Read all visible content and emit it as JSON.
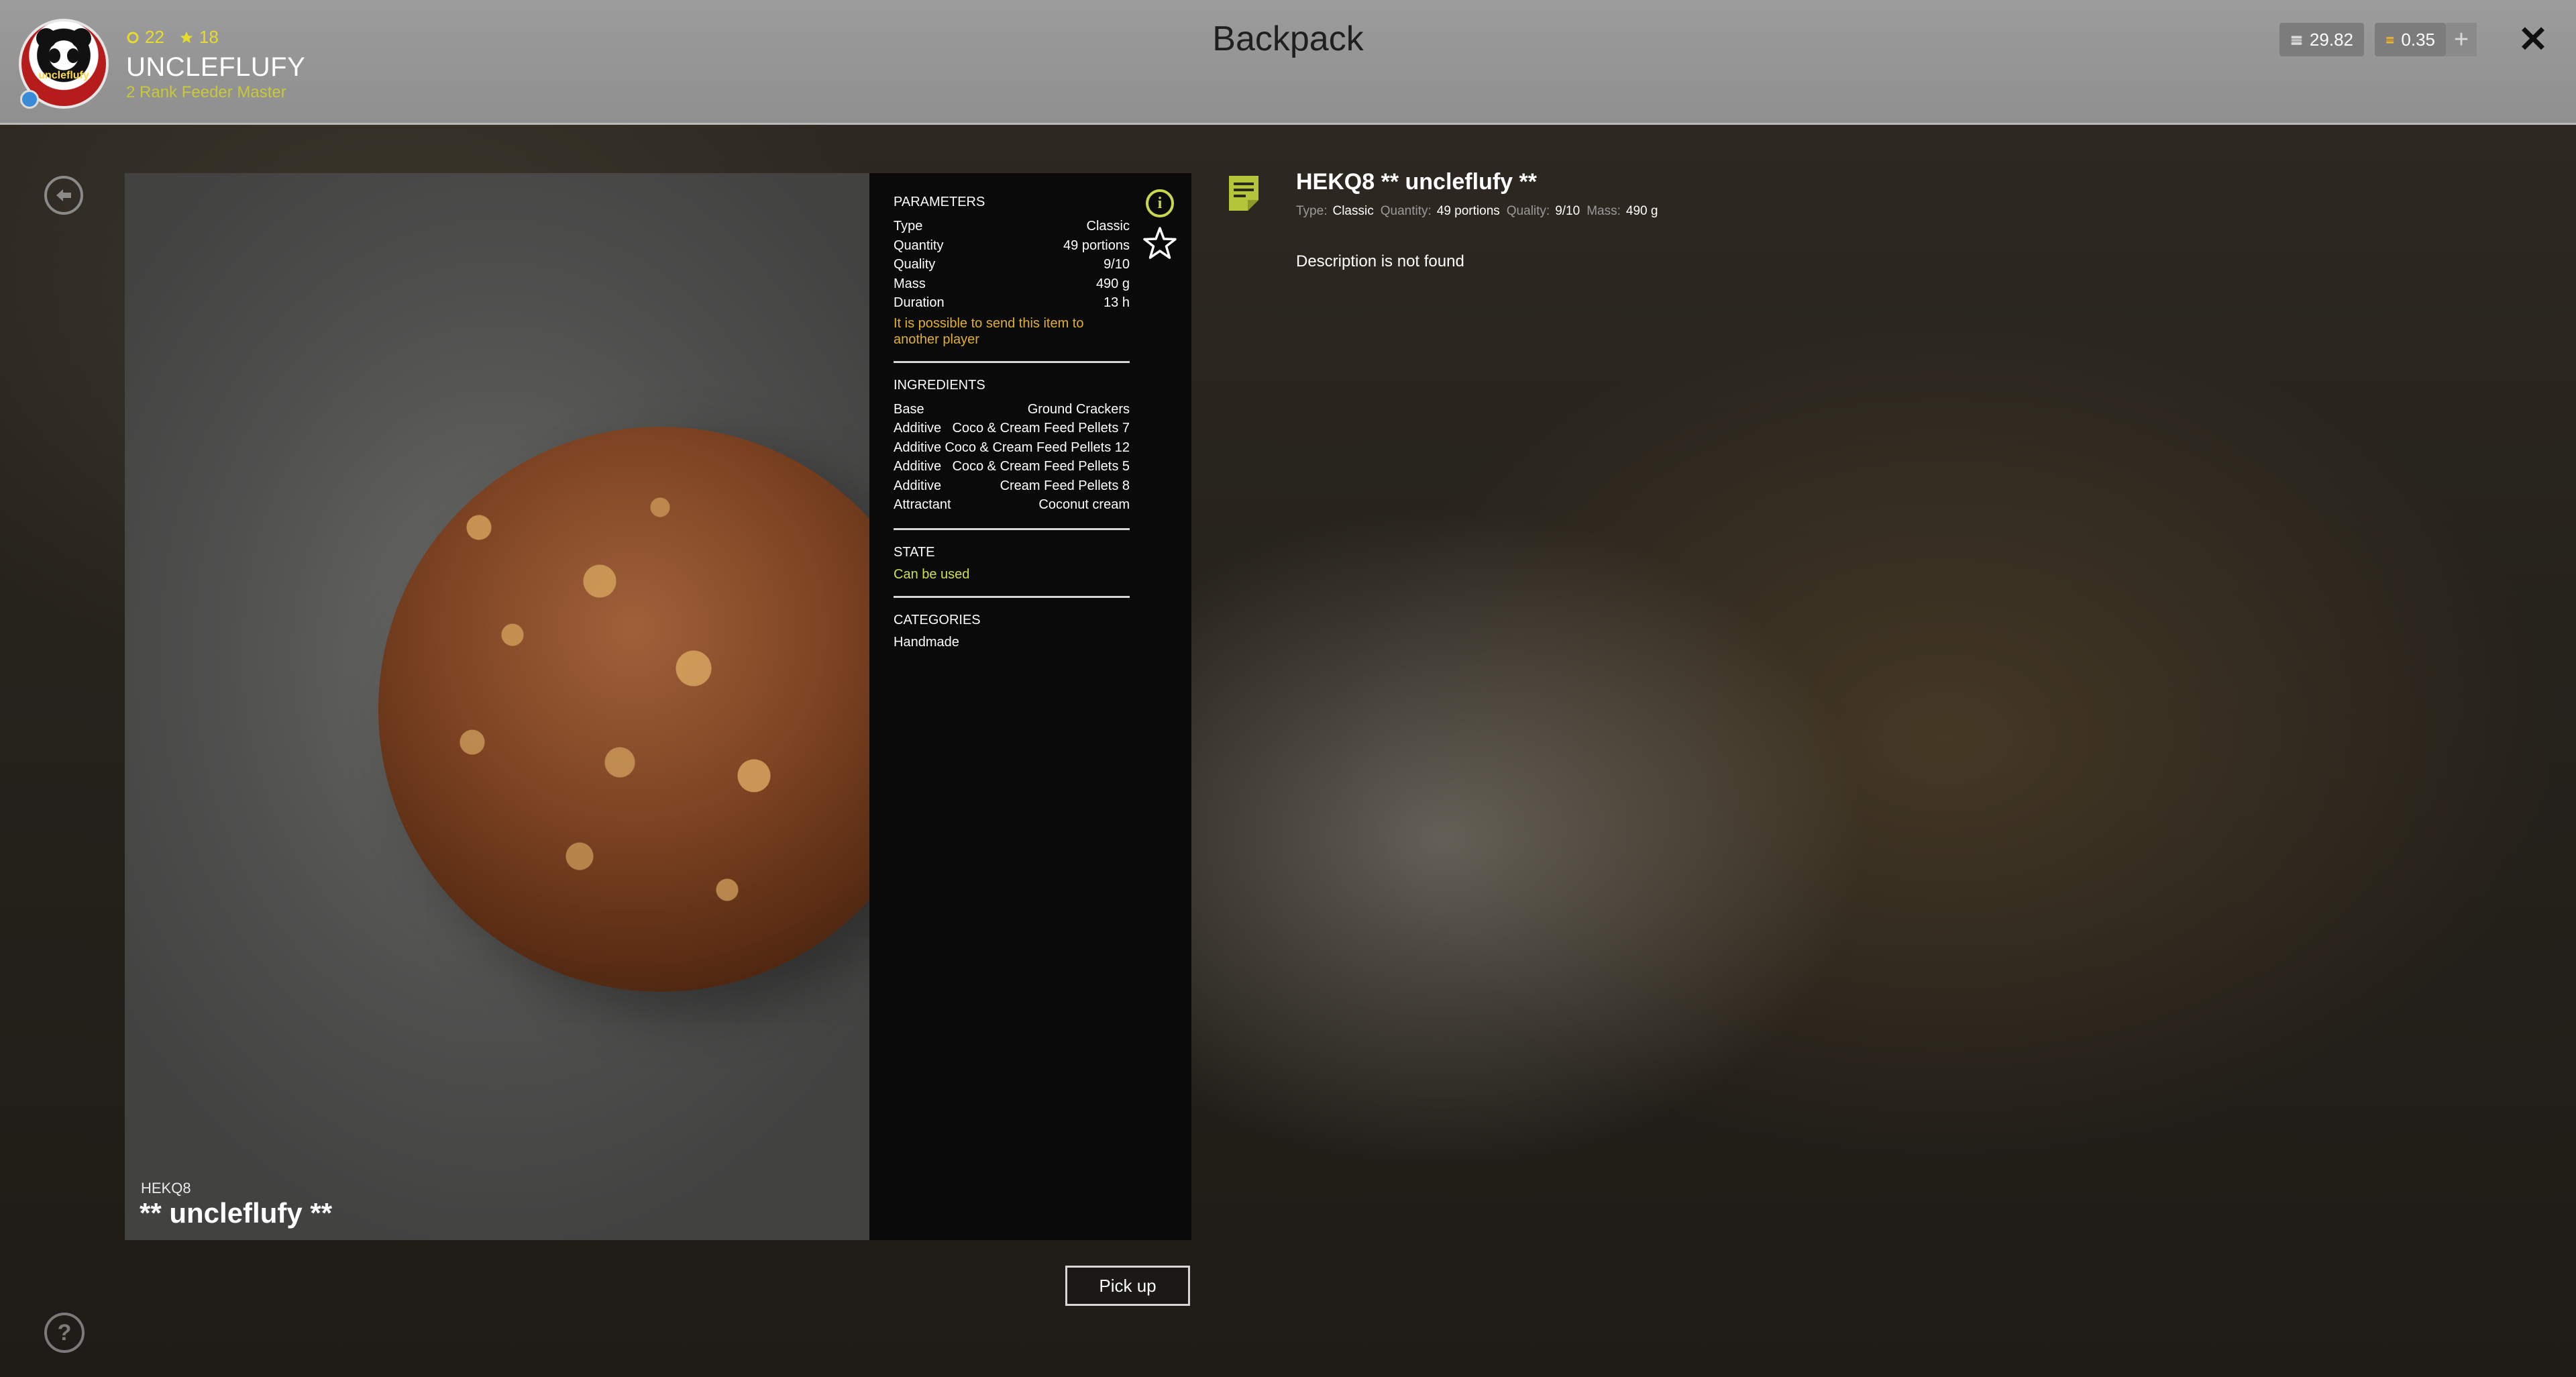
{
  "header": {
    "title": "Backpack",
    "user": {
      "name": "UNCLEFLUFY",
      "rank": "2 Rank Feeder Master",
      "avatar_text": "uncleflufy",
      "stat_level": "22",
      "stat_stars": "18"
    },
    "currency": [
      {
        "icon": "silver-coins-icon",
        "value": "29.82"
      },
      {
        "icon": "gold-coins-icon",
        "value": "0.35"
      }
    ],
    "plus_label": "+",
    "close_label": "✕"
  },
  "preview": {
    "code": "HEKQ8",
    "name": "** uncleflufy **"
  },
  "info": {
    "parameters_title": "PARAMETERS",
    "parameters": [
      {
        "label": "Type",
        "value": "Classic"
      },
      {
        "label": "Quantity",
        "value": "49 portions"
      },
      {
        "label": "Quality",
        "value": "9/10"
      },
      {
        "label": "Mass",
        "value": "490 g"
      },
      {
        "label": "Duration",
        "value": "13 h"
      }
    ],
    "send_note": "It is possible to send this item to another player",
    "ingredients_title": "INGREDIENTS",
    "ingredients": [
      {
        "label": "Base",
        "value": "Ground Crackers"
      },
      {
        "label": "Additive",
        "value": "Coco & Cream Feed Pellets 7"
      },
      {
        "label": "Additive",
        "value": "Coco & Cream Feed Pellets 12"
      },
      {
        "label": "Additive",
        "value": "Coco & Cream Feed Pellets 5"
      },
      {
        "label": "Additive",
        "value": "Cream Feed Pellets 8"
      },
      {
        "label": "Attractant",
        "value": "Coconut cream"
      }
    ],
    "state_title": "STATE",
    "state_value": "Can be used",
    "categories_title": "CATEGORIES",
    "categories_value": "Handmade"
  },
  "pickup_label": "Pick up",
  "detail": {
    "title": "HEKQ8 ** uncleflufy **",
    "meta": [
      {
        "label": "Type:",
        "value": "Classic"
      },
      {
        "label": "Quantity:",
        "value": "49 portions"
      },
      {
        "label": "Quality:",
        "value": "9/10"
      },
      {
        "label": "Mass:",
        "value": "490 g"
      }
    ],
    "description": "Description is not found"
  },
  "colors": {
    "accent_yellow": "#e2b12a",
    "accent_green": "#cde04a",
    "header_bg": "#9c9c9c",
    "panel_bg": "#0a0a0a"
  }
}
